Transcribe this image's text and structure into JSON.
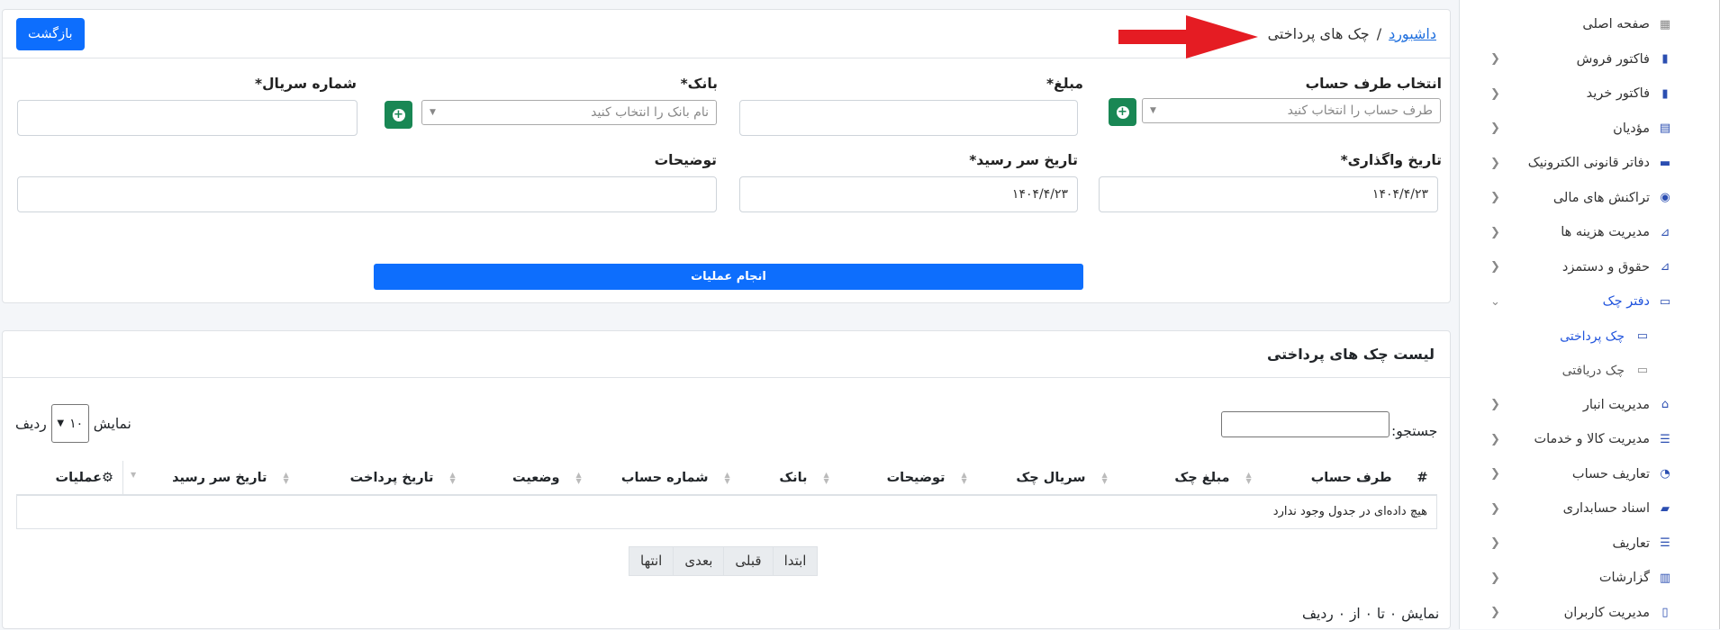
{
  "sidebar": {
    "items": [
      {
        "label": "صفحه اصلی",
        "icon": "grid-icon",
        "chevron": false
      },
      {
        "label": "فاکتور فروش",
        "icon": "invoice-icon",
        "chevron": true
      },
      {
        "label": "فاکتور خرید",
        "icon": "invoice-icon",
        "chevron": true
      },
      {
        "label": "مؤدیان",
        "icon": "chart-icon",
        "chevron": true
      },
      {
        "label": "دفاتر قانونی الکترونیک",
        "icon": "book-icon",
        "chevron": true
      },
      {
        "label": "تراکنش های مالی",
        "icon": "coins-icon",
        "chevron": true
      },
      {
        "label": "مدیریت هزینه ها",
        "icon": "line-chart-icon",
        "chevron": true
      },
      {
        "label": "حقوق و دستمزد",
        "icon": "line-chart-icon",
        "chevron": true
      },
      {
        "label": "دفتر چک",
        "icon": "money-bill-icon",
        "chevron": true,
        "expanded": true
      }
    ],
    "subitems": [
      {
        "label": "چک پرداختی",
        "icon": "money-bill-icon",
        "active": true
      },
      {
        "label": "چک دریافتی",
        "icon": "money-bill-icon",
        "active": false
      }
    ],
    "items2": [
      {
        "label": "مدیریت انبار",
        "icon": "warehouse-icon"
      },
      {
        "label": "مدیریت کالا و خدمات",
        "icon": "list-icon"
      },
      {
        "label": "تعاریف حساب",
        "icon": "pie-chart-icon"
      },
      {
        "label": "اسناد حسابداری",
        "icon": "folder-icon"
      },
      {
        "label": "تعاریف",
        "icon": "list-icon"
      },
      {
        "label": "گزارشات",
        "icon": "bar-chart-icon"
      },
      {
        "label": "مدیریت کاربران",
        "icon": "user-file-icon"
      }
    ]
  },
  "header": {
    "breadcrumb_root": "داشبورد",
    "breadcrumb_sep": "/",
    "breadcrumb_current": "چک های پرداختی",
    "back_button": "بازگشت"
  },
  "form": {
    "account_label": "انتخاب طرف حساب",
    "account_placeholder": "طرف حساب را انتخاب کنید",
    "amount_label": "مبلغ*",
    "bank_label": "بانک*",
    "bank_placeholder": "نام بانک را انتخاب کنید",
    "serial_label": "شماره سریال*",
    "assign_date_label": "تاریخ واگذاری*",
    "assign_date_value": "۱۴۰۴/۴/۲۳",
    "due_date_label": "تاریخ سر رسید*",
    "due_date_value": "۱۴۰۴/۴/۲۳",
    "description_label": "توضیحات",
    "submit_button": "انجام عملیات"
  },
  "list": {
    "title": "لیست چک های پرداختی",
    "search_label": "جستجو:",
    "show_label": "نمایش",
    "rows_label": "ردیف",
    "page_size": "۱۰",
    "columns": [
      "#",
      "طرف حساب",
      "مبلغ چک",
      "سریال چک",
      "توضیحات",
      "بانک",
      "شماره حساب",
      "وضعیت",
      "تاریخ پرداخت",
      "تاریخ سر رسید",
      "عملیات"
    ],
    "empty_text": "هیچ داده‌ای در جدول وجود ندارد",
    "pager": [
      "ابتدا",
      "قبلی",
      "بعدی",
      "انتها"
    ],
    "info": "نمایش ۰ تا ۰ از ۰ ردیف"
  },
  "colors": {
    "primary": "#0d6efd",
    "success": "#198754",
    "arrow": "#e51c23",
    "link": "#1f6fde"
  }
}
